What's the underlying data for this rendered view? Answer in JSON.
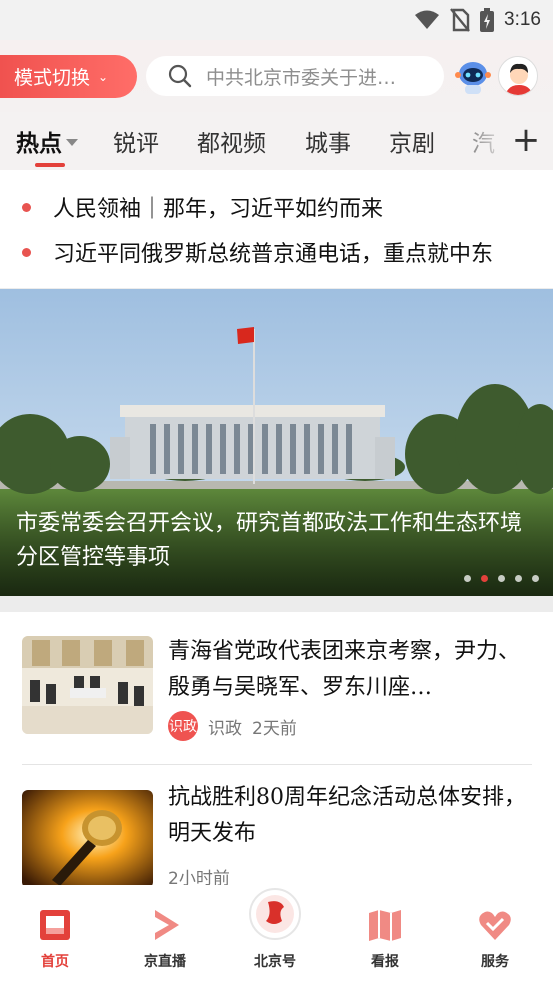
{
  "status_bar": {
    "time": "3:16",
    "icons": [
      "wifi-icon",
      "no-sim-icon",
      "battery-charging-icon"
    ]
  },
  "top_bar": {
    "mode_button": "模式切换",
    "search_placeholder": "中共北京市委关于进…",
    "robot_icon": "robot-assistant-icon",
    "avatar_icon": "user-avatar-icon"
  },
  "tabs": [
    {
      "label": "热点",
      "active": true
    },
    {
      "label": "锐评"
    },
    {
      "label": "都视频"
    },
    {
      "label": "城事"
    },
    {
      "label": "京剧"
    },
    {
      "label": "汽"
    }
  ],
  "headlines": [
    "人民领袖｜那年，习近平如约而来",
    "习近平同俄罗斯总统普京通电话，重点就中东"
  ],
  "carousel": {
    "title": "市委常委会召开会议，研究首都政法工作和生态环境分区管控等事项",
    "dot_count": 5,
    "active_dot": 1
  },
  "news": [
    {
      "title": "青海省党政代表团来京考察，尹力、殷勇与吴晓军、罗东川座…",
      "source_badge": "识政",
      "source": "识政",
      "time": "2天前"
    },
    {
      "title": "抗战胜利80周年纪念活动总体安排，明天发布",
      "time": "2小时前"
    }
  ],
  "bottom_nav": [
    {
      "label": "首页",
      "active": true
    },
    {
      "label": "京直播"
    },
    {
      "label": "北京号"
    },
    {
      "label": "看报"
    },
    {
      "label": "服务"
    }
  ],
  "colors": {
    "accent": "#e3413b",
    "mode_button": "#f0524f"
  }
}
